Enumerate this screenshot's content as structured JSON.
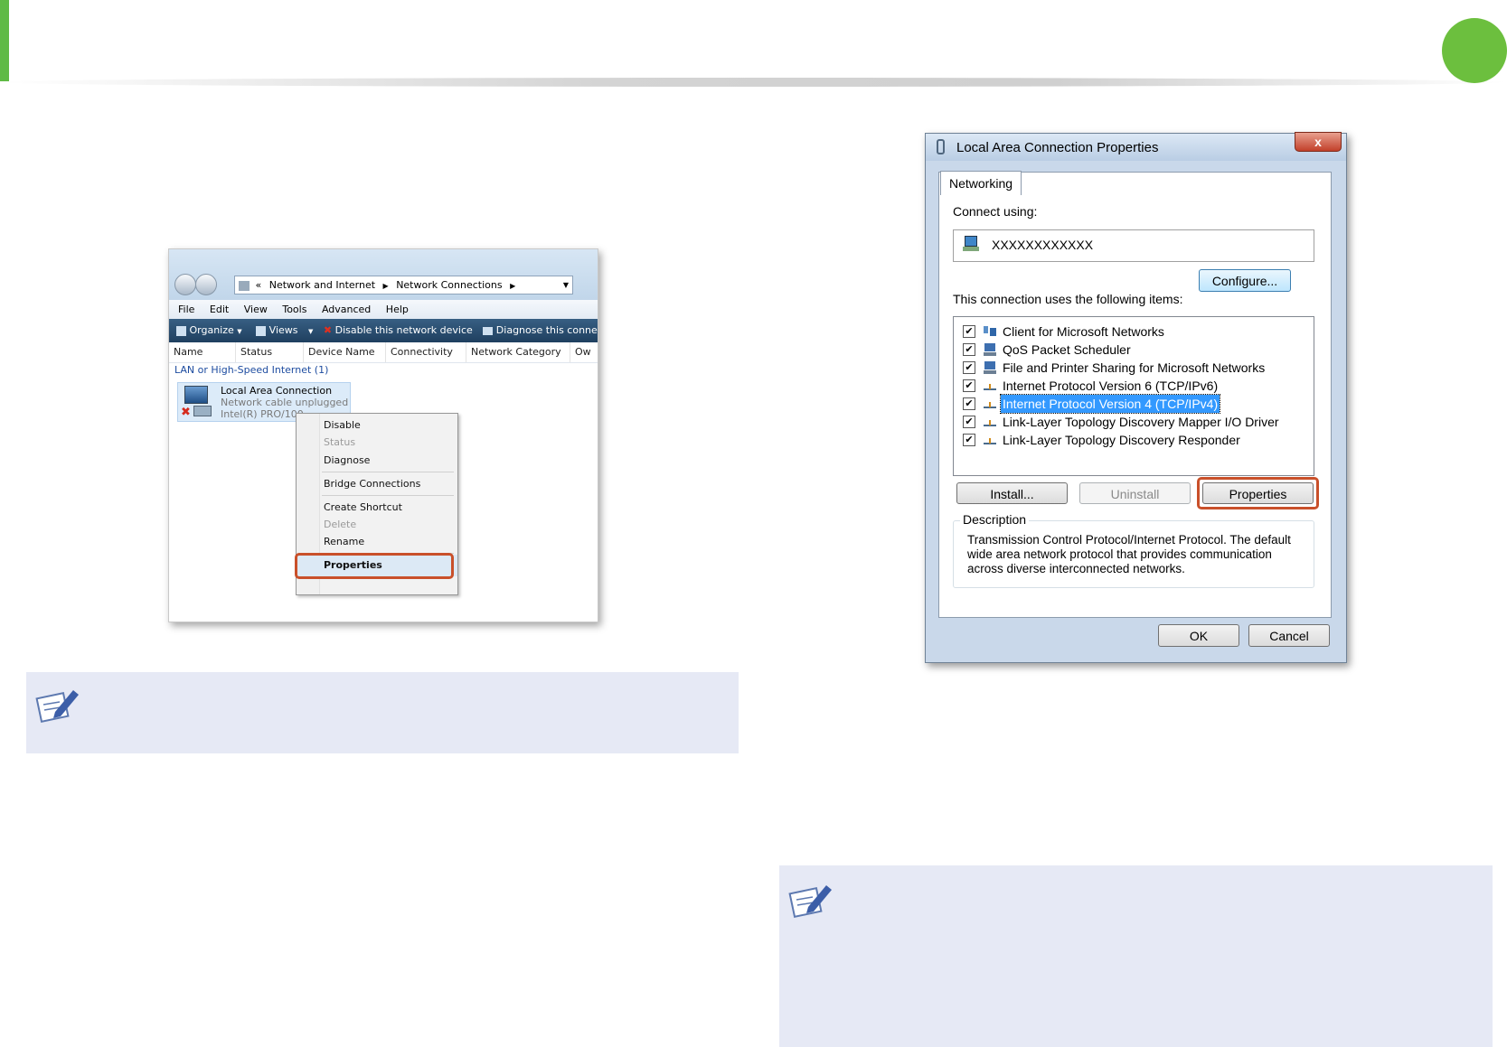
{
  "explorer": {
    "address": {
      "chevrons": "«",
      "crumb1": "Network and Internet",
      "crumb2": "Network Connections"
    },
    "menu": [
      "File",
      "Edit",
      "View",
      "Tools",
      "Advanced",
      "Help"
    ],
    "toolbar": {
      "organize": "Organize",
      "views": "Views",
      "disable_device": "Disable this network device",
      "diagnose": "Diagnose this connec"
    },
    "columns": [
      "Name",
      "Status",
      "Device Name",
      "Connectivity",
      "Network Category",
      "Ow"
    ],
    "group_label": "LAN or High-Speed Internet (1)",
    "connection": {
      "name": "Local Area Connection",
      "status": "Network cable unplugged",
      "device": "Intel(R) PRO/100"
    },
    "context_menu": {
      "disable": "Disable",
      "status": "Status",
      "diagnose": "Diagnose",
      "bridge": "Bridge Connections",
      "shortcut": "Create Shortcut",
      "delete": "Delete",
      "rename": "Rename",
      "properties": "Properties"
    }
  },
  "dialog": {
    "title": "Local Area Connection Properties",
    "close_glyph": "x",
    "tab": "Networking",
    "connect_using_label": "Connect using:",
    "adapter_name": "XXXXXXXXXXXX",
    "configure_button": "Configure...",
    "items_label": "This connection uses the following items:",
    "items": [
      {
        "label": "Client for Microsoft Networks",
        "checked": true
      },
      {
        "label": "QoS Packet Scheduler",
        "checked": true
      },
      {
        "label": "File and Printer Sharing for Microsoft Networks",
        "checked": true
      },
      {
        "label": "Internet Protocol Version 6 (TCP/IPv6)",
        "checked": true
      },
      {
        "label": "Internet Protocol Version 4 (TCP/IPv4)",
        "checked": true,
        "selected": true
      },
      {
        "label": "Link-Layer Topology Discovery Mapper I/O Driver",
        "checked": true
      },
      {
        "label": "Link-Layer Topology Discovery Responder",
        "checked": true
      }
    ],
    "install_button": "Install...",
    "uninstall_button": "Uninstall",
    "properties_button": "Properties",
    "description_legend": "Description",
    "description_text": "Transmission Control Protocol/Internet Protocol. The default wide area network protocol that provides communication across diverse interconnected networks.",
    "ok_button": "OK",
    "cancel_button": "Cancel"
  },
  "colors": {
    "accent_green": "#6cbf3e",
    "highlight_ring": "#c9502a",
    "note_background": "#e6e9f5",
    "selection_blue": "#3399ff"
  }
}
